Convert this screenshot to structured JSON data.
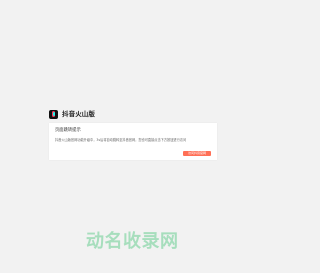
{
  "app": {
    "brand_name": "抖音火山版",
    "logo_icon": "douyin-logo-icon"
  },
  "notice": {
    "title": "页面跳转提示",
    "message": "抖音火山版官网功能升级中，3s后将自动跳转至抖音官网，您也可直接点击下方按钮进行访问",
    "redirect_button_label": "访问抖音官网"
  },
  "watermark": {
    "text": "动名收录网"
  },
  "colors": {
    "background": "#f2f2f2",
    "card": "#ffffff",
    "button": "#ff6f56",
    "watermark": "#9fdcb8"
  }
}
